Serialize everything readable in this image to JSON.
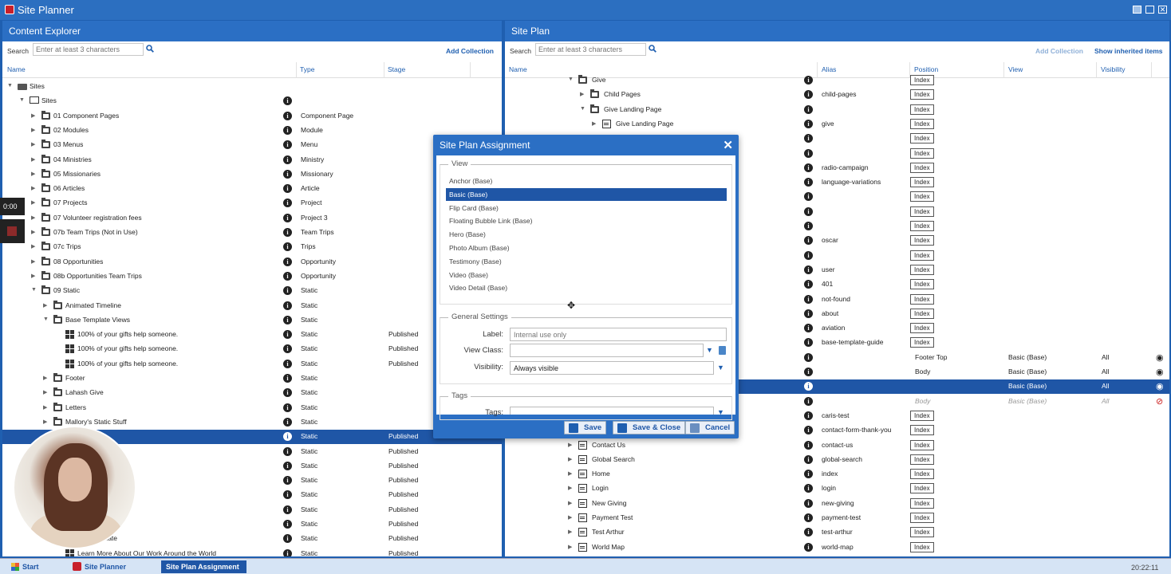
{
  "app": {
    "title": "Site Planner"
  },
  "content_explorer": {
    "title": "Content Explorer",
    "search_label": "Search",
    "search_placeholder": "Enter at least 3 characters",
    "add_collection": "Add Collection",
    "columns": {
      "name": "Name",
      "type": "Type",
      "stage": "Stage"
    },
    "rows": [
      {
        "label": "Sites",
        "type": "",
        "stage": "",
        "level": 0,
        "icon": "sites",
        "exp": "down"
      },
      {
        "label": "Sites",
        "type": "",
        "stage": "",
        "level": 1,
        "icon": "monitor",
        "exp": "down"
      },
      {
        "label": "01 Component Pages",
        "type": "Component Page",
        "stage": "",
        "level": 2,
        "icon": "folder",
        "exp": "right"
      },
      {
        "label": "02 Modules",
        "type": "Module",
        "stage": "",
        "level": 2,
        "icon": "folder",
        "exp": "right"
      },
      {
        "label": "03 Menus",
        "type": "Menu",
        "stage": "",
        "level": 2,
        "icon": "folder",
        "exp": "right"
      },
      {
        "label": "04 Ministries",
        "type": "Ministry",
        "stage": "",
        "level": 2,
        "icon": "folder",
        "exp": "right"
      },
      {
        "label": "05 Missionaries",
        "type": "Missionary",
        "stage": "",
        "level": 2,
        "icon": "folder",
        "exp": "right"
      },
      {
        "label": "06 Articles",
        "type": "Article",
        "stage": "",
        "level": 2,
        "icon": "folder",
        "exp": "right"
      },
      {
        "label": "07 Projects",
        "type": "Project",
        "stage": "",
        "level": 2,
        "icon": "folder",
        "exp": "right"
      },
      {
        "label": "07 Volunteer registration fees",
        "type": "Project 3",
        "stage": "",
        "level": 2,
        "icon": "folder",
        "exp": "right"
      },
      {
        "label": "07b Team Trips (Not in Use)",
        "type": "Team Trips",
        "stage": "",
        "level": 2,
        "icon": "folder",
        "exp": "right"
      },
      {
        "label": "07c Trips",
        "type": "Trips",
        "stage": "",
        "level": 2,
        "icon": "folder",
        "exp": "right"
      },
      {
        "label": "08 Opportunities",
        "type": "Opportunity",
        "stage": "",
        "level": 2,
        "icon": "folder",
        "exp": "right"
      },
      {
        "label": "08b Opportunities Team Trips",
        "type": "Opportunity",
        "stage": "",
        "level": 2,
        "icon": "folder",
        "exp": "right"
      },
      {
        "label": "09 Static",
        "type": "Static",
        "stage": "",
        "level": 2,
        "icon": "folder",
        "exp": "down"
      },
      {
        "label": "Animated Timeline",
        "type": "Static",
        "stage": "",
        "level": 3,
        "icon": "folder",
        "exp": "right"
      },
      {
        "label": "Base Template Views",
        "type": "Static",
        "stage": "",
        "level": 3,
        "icon": "folder",
        "exp": "down"
      },
      {
        "label": "100% of your gifts help someone.",
        "type": "Static",
        "stage": "Published",
        "level": 4,
        "icon": "grid",
        "exp": ""
      },
      {
        "label": "100% of your gifts help someone.",
        "type": "Static",
        "stage": "Published",
        "level": 4,
        "icon": "grid",
        "exp": ""
      },
      {
        "label": "100% of your gifts help someone.",
        "type": "Static",
        "stage": "Published",
        "level": 4,
        "icon": "grid",
        "exp": ""
      },
      {
        "label": "Footer",
        "type": "Static",
        "stage": "",
        "level": 3,
        "icon": "folder",
        "exp": "right"
      },
      {
        "label": "Lahash Give",
        "type": "Static",
        "stage": "",
        "level": 3,
        "icon": "folder",
        "exp": "right"
      },
      {
        "label": "Letters",
        "type": "Static",
        "stage": "",
        "level": 3,
        "icon": "folder",
        "exp": "right"
      },
      {
        "label": "Mallory's Static Stuff",
        "type": "Static",
        "stage": "",
        "level": 3,
        "icon": "folder",
        "exp": "right"
      },
      {
        "label": "",
        "type": "Static",
        "stage": "Published",
        "level": 4,
        "icon": "",
        "exp": "",
        "sel": true
      },
      {
        "label": "",
        "type": "Static",
        "stage": "Published",
        "level": 4,
        "icon": "",
        "exp": ""
      },
      {
        "label": "",
        "type": "Static",
        "stage": "Published",
        "level": 4,
        "icon": "",
        "exp": ""
      },
      {
        "label": "",
        "type": "Static",
        "stage": "Published",
        "level": 4,
        "icon": "",
        "exp": ""
      },
      {
        "label": "onaries",
        "type": "Static",
        "stage": "Published",
        "level": 6,
        "icon": "",
        "exp": ""
      },
      {
        "label": "",
        "type": "Static",
        "stage": "Published",
        "level": 4,
        "icon": "",
        "exp": ""
      },
      {
        "label": "",
        "type": "Static",
        "stage": "Published",
        "level": 4,
        "icon": "",
        "exp": ""
      },
      {
        "label": "Alternate",
        "type": "Static",
        "stage": "Published",
        "level": 6,
        "icon": "",
        "exp": ""
      },
      {
        "label": "Learn More About Our Work Around the World",
        "type": "Static",
        "stage": "Published",
        "level": 4,
        "icon": "grid",
        "exp": ""
      }
    ]
  },
  "site_plan": {
    "title": "Site Plan",
    "search_label": "Search",
    "search_placeholder": "Enter at least 3 characters",
    "add_collection": "Add Collection",
    "show_inherited": "Show inherited items",
    "columns": {
      "name": "Name",
      "alias": "Alias",
      "position": "Position",
      "view": "View",
      "visibility": "Visibility"
    },
    "rows": [
      {
        "label": "Give",
        "alias": "",
        "position": "Index",
        "view": "",
        "vis": "",
        "indent": 1,
        "icon": "folder",
        "exp": "down"
      },
      {
        "label": "Child Pages",
        "alias": "child-pages",
        "position": "Index",
        "view": "",
        "vis": "",
        "indent": 2,
        "icon": "folder",
        "exp": "right"
      },
      {
        "label": "Give Landing Page",
        "alias": "",
        "position": "Index",
        "view": "",
        "vis": "",
        "indent": 2,
        "icon": "folder",
        "exp": "down"
      },
      {
        "label": "Give Landing Page",
        "alias": "give",
        "position": "Index",
        "view": "",
        "vis": "",
        "indent": 3,
        "icon": "comp",
        "exp": "right"
      },
      {
        "label": "",
        "alias": "",
        "position": "Index",
        "view": "",
        "vis": "",
        "indent": 3,
        "icon": "",
        "exp": ""
      },
      {
        "label": "",
        "alias": "",
        "position": "Index",
        "view": "",
        "vis": "",
        "indent": 3,
        "icon": "",
        "exp": ""
      },
      {
        "label": "",
        "alias": "radio-campaign",
        "position": "Index",
        "view": "",
        "vis": "",
        "indent": 3,
        "icon": "",
        "exp": ""
      },
      {
        "label": "",
        "alias": "language-variations",
        "position": "Index",
        "view": "",
        "vis": "",
        "indent": 3,
        "icon": "",
        "exp": ""
      },
      {
        "label": "",
        "alias": "",
        "position": "Index",
        "view": "",
        "vis": "",
        "indent": 3,
        "icon": "",
        "exp": ""
      },
      {
        "label": "",
        "alias": "",
        "position": "Index",
        "view": "",
        "vis": "",
        "indent": 3,
        "icon": "",
        "exp": ""
      },
      {
        "label": "",
        "alias": "",
        "position": "Index",
        "view": "",
        "vis": "",
        "indent": 3,
        "icon": "",
        "exp": ""
      },
      {
        "label": "",
        "alias": "oscar",
        "position": "Index",
        "view": "",
        "vis": "",
        "indent": 3,
        "icon": "",
        "exp": ""
      },
      {
        "label": "",
        "alias": "",
        "position": "Index",
        "view": "",
        "vis": "",
        "indent": 3,
        "icon": "",
        "exp": ""
      },
      {
        "label": "",
        "alias": "user",
        "position": "Index",
        "view": "",
        "vis": "",
        "indent": 3,
        "icon": "",
        "exp": ""
      },
      {
        "label": "",
        "alias": "401",
        "position": "Index",
        "view": "",
        "vis": "",
        "indent": 3,
        "icon": "",
        "exp": ""
      },
      {
        "label": "",
        "alias": "not-found",
        "position": "Index",
        "view": "",
        "vis": "",
        "indent": 3,
        "icon": "",
        "exp": ""
      },
      {
        "label": "",
        "alias": "about",
        "position": "Index",
        "view": "",
        "vis": "",
        "indent": 3,
        "icon": "",
        "exp": ""
      },
      {
        "label": "",
        "alias": "aviation",
        "position": "Index",
        "view": "",
        "vis": "",
        "indent": 3,
        "icon": "",
        "exp": ""
      },
      {
        "label": "",
        "alias": "base-template-guide",
        "position": "Index",
        "view": "",
        "vis": "",
        "indent": 3,
        "icon": "",
        "exp": ""
      },
      {
        "label": "",
        "alias": "",
        "position": "Footer Top",
        "view": "Basic (Base)",
        "vis": "All",
        "indent": 3,
        "icon": "",
        "exp": "",
        "eye": "on"
      },
      {
        "label": "",
        "alias": "",
        "position": "Body",
        "view": "Basic (Base)",
        "vis": "All",
        "indent": 3,
        "icon": "",
        "exp": "",
        "eye": "on"
      },
      {
        "label": "",
        "alias": "",
        "position": "",
        "view": "Basic (Base)",
        "vis": "All",
        "indent": 3,
        "icon": "",
        "exp": "",
        "eye": "on",
        "sel": true
      },
      {
        "label": "",
        "alias": "",
        "position": "Body",
        "view": "Basic (Base)",
        "vis": "All",
        "indent": 3,
        "icon": "",
        "exp": "",
        "eye": "off",
        "italic": true
      },
      {
        "label": "",
        "alias": "caris-test",
        "position": "Index",
        "view": "",
        "vis": "",
        "indent": 3,
        "icon": "",
        "exp": ""
      },
      {
        "label": "",
        "alias": "contact-form-thank-you",
        "position": "Index",
        "view": "",
        "vis": "",
        "indent": 3,
        "icon": "",
        "exp": ""
      },
      {
        "label": "Contact Us",
        "alias": "contact-us",
        "position": "Index",
        "view": "",
        "vis": "",
        "indent": 1,
        "icon": "comp",
        "exp": "right"
      },
      {
        "label": "Global Search",
        "alias": "global-search",
        "position": "Index",
        "view": "",
        "vis": "",
        "indent": 1,
        "icon": "comp",
        "exp": "right"
      },
      {
        "label": "Home",
        "alias": "index",
        "position": "Index",
        "view": "",
        "vis": "",
        "indent": 1,
        "icon": "comp",
        "exp": "right"
      },
      {
        "label": "Login",
        "alias": "login",
        "position": "Index",
        "view": "",
        "vis": "",
        "indent": 1,
        "icon": "comp",
        "exp": "right"
      },
      {
        "label": "New Giving",
        "alias": "new-giving",
        "position": "Index",
        "view": "",
        "vis": "",
        "indent": 1,
        "icon": "comp",
        "exp": "right"
      },
      {
        "label": "Payment Test",
        "alias": "payment-test",
        "position": "Index",
        "view": "",
        "vis": "",
        "indent": 1,
        "icon": "comp",
        "exp": "right"
      },
      {
        "label": "Test Arthur",
        "alias": "test-arthur",
        "position": "Index",
        "view": "",
        "vis": "",
        "indent": 1,
        "icon": "comp",
        "exp": "right"
      },
      {
        "label": "World Map",
        "alias": "world-map",
        "position": "Index",
        "view": "",
        "vis": "",
        "indent": 1,
        "icon": "comp",
        "exp": "right"
      }
    ]
  },
  "dialog": {
    "title": "Site Plan Assignment",
    "view_legend": "View",
    "views": [
      "Anchor (Base)",
      "Basic (Base)",
      "Flip Card (Base)",
      "Floating Bubble Link (Base)",
      "Hero (Base)",
      "Photo Album (Base)",
      "Testimony (Base)",
      "Video (Base)",
      "Video Detail (Base)"
    ],
    "selected_view": "Basic (Base)",
    "general_legend": "General Settings",
    "label_label": "Label:",
    "label_placeholder": "Internal use only",
    "viewclass_label": "View Class:",
    "viewclass_value": "",
    "visibility_label": "Visibility:",
    "visibility_value": "Always visible",
    "tags_legend": "Tags",
    "tags_label": "Tags:",
    "save": "Save",
    "save_close": "Save & Close",
    "cancel": "Cancel"
  },
  "recorder": {
    "time": "0:00"
  },
  "taskbar": {
    "start": "Start",
    "items": [
      "Site Planner",
      "Site Plan Assignment"
    ],
    "clock": "20:22:11"
  },
  "colors": {
    "accent": "#1f56a6",
    "header": "#2b6fc4",
    "selection": "#1f56a6"
  }
}
